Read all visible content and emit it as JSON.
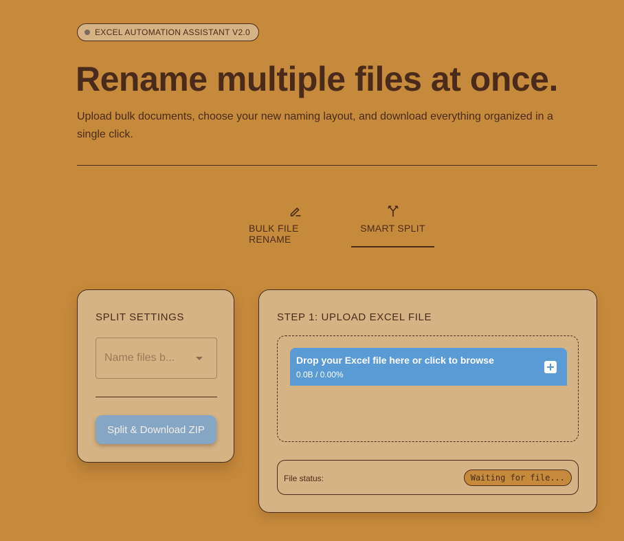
{
  "header": {
    "badge_label": "EXCEL AUTOMATION ASSISTANT V2.0",
    "title": "Rename multiple files at once.",
    "subtitle": "Upload bulk documents, choose your new naming layout, and download everything organized in a single click."
  },
  "tabs": [
    {
      "label": "BULK FILE RENAME",
      "icon": "pencil-icon",
      "active": false
    },
    {
      "label": "SMART SPLIT",
      "icon": "split-arrows-icon",
      "active": true
    }
  ],
  "split_settings": {
    "heading": "SPLIT SETTINGS",
    "name_files_placeholder": "Name files b...",
    "split_button_label": "Split & Download ZIP"
  },
  "upload": {
    "heading": "STEP 1: UPLOAD EXCEL FILE",
    "drop_label": "Drop your Excel file here or click to browse",
    "progress_text": "0.0B / 0.00%",
    "status_label": "File status:",
    "status_value": "Waiting for file..."
  },
  "colors": {
    "background": "#c68a3c",
    "card": "#d5b384",
    "text": "#4a2a1a",
    "upload_bar": "#5b9bd5",
    "button": "#85a6c4"
  }
}
